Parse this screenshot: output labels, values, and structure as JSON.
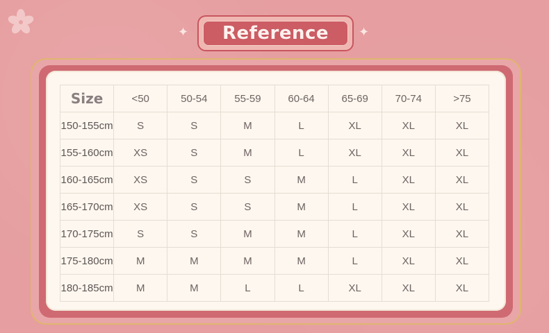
{
  "title": "Reference",
  "table": {
    "corner_label": "Size",
    "columns": [
      "<50",
      "50-54",
      "55-59",
      "60-64",
      "65-69",
      "70-74",
      ">75"
    ],
    "rows": [
      {
        "height": "150-155cm",
        "cells": [
          "S",
          "S",
          "M",
          "L",
          "XL",
          "XL",
          "XL"
        ]
      },
      {
        "height": "155-160cm",
        "cells": [
          "XS",
          "S",
          "M",
          "L",
          "XL",
          "XL",
          "XL"
        ]
      },
      {
        "height": "160-165cm",
        "cells": [
          "XS",
          "S",
          "S",
          "M",
          "L",
          "XL",
          "XL"
        ]
      },
      {
        "height": "165-170cm",
        "cells": [
          "XS",
          "S",
          "S",
          "M",
          "L",
          "XL",
          "XL"
        ]
      },
      {
        "height": "170-175cm",
        "cells": [
          "S",
          "S",
          "M",
          "M",
          "L",
          "XL",
          "XL"
        ]
      },
      {
        "height": "175-180cm",
        "cells": [
          "M",
          "M",
          "M",
          "M",
          "L",
          "XL",
          "XL"
        ]
      },
      {
        "height": "180-185cm",
        "cells": [
          "M",
          "M",
          "L",
          "L",
          "XL",
          "XL",
          "XL"
        ]
      }
    ]
  },
  "colors": {
    "background": "#e69ea0",
    "banner": "#cc5d65",
    "card": "#fdf7ef",
    "text": "#6e6262",
    "gold_border": "#dfb66f"
  }
}
